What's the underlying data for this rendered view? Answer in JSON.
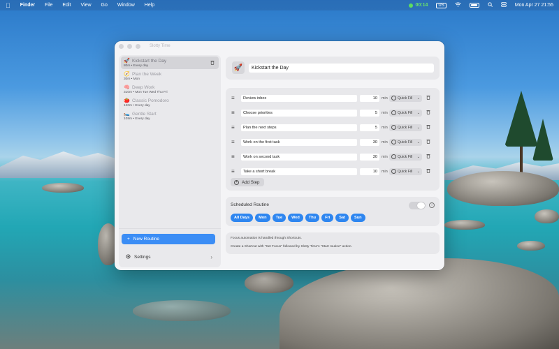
{
  "menubar": {
    "apple": "",
    "items": [
      "Finder",
      "File",
      "Edit",
      "View",
      "Go",
      "Window",
      "Help"
    ],
    "timer": "00:14",
    "input_source": "US",
    "datetime": "Mon Apr 27  21:55"
  },
  "window": {
    "title": "Slotty Time"
  },
  "sidebar": {
    "routines": [
      {
        "icon": "🚀",
        "name": "Kickstart the Day",
        "sub": "80m • Every day",
        "selected": true
      },
      {
        "icon": "🧭",
        "name": "Plan the Week",
        "sub": "30m • Mon",
        "selected": false
      },
      {
        "icon": "🧠",
        "name": "Deep Work",
        "sub": "310m • Mon Tue Wed Thu Fri",
        "selected": false
      },
      {
        "icon": "🍅",
        "name": "Classic Pomodoro",
        "sub": "120m • Every day",
        "selected": false
      },
      {
        "icon": "🛌",
        "name": "Gentle Start",
        "sub": "108m • Every day",
        "selected": false
      }
    ],
    "new_routine": "New Routine",
    "settings": "Settings"
  },
  "routine": {
    "icon": "🚀",
    "name": "Kickstart the Day"
  },
  "steps": [
    {
      "title": "Review inbox",
      "minutes": "10"
    },
    {
      "title": "Choose priorities",
      "minutes": "5"
    },
    {
      "title": "Plan the next steps",
      "minutes": "5"
    },
    {
      "title": "Work on the first task",
      "minutes": "30"
    },
    {
      "title": "Work on second task",
      "minutes": "30"
    },
    {
      "title": "Take a short break",
      "minutes": "10"
    }
  ],
  "step_labels": {
    "min": "min",
    "quick_fill": "Quick Fill",
    "add_step": "Add Step"
  },
  "schedule": {
    "title": "Scheduled Routine",
    "enabled": false,
    "days": [
      "All Days",
      "Mon",
      "Tue",
      "Wed",
      "Thu",
      "Fri",
      "Sat",
      "Sun"
    ]
  },
  "note": {
    "line1": "Focus automation is handled through Shortcuts.",
    "line2": "Create a Shortcut with \"Set Focus\" followed by Slotty Time's \"Start routine\" action."
  },
  "colors": {
    "accent": "#2e86f0",
    "timer": "#5fdc5f"
  }
}
